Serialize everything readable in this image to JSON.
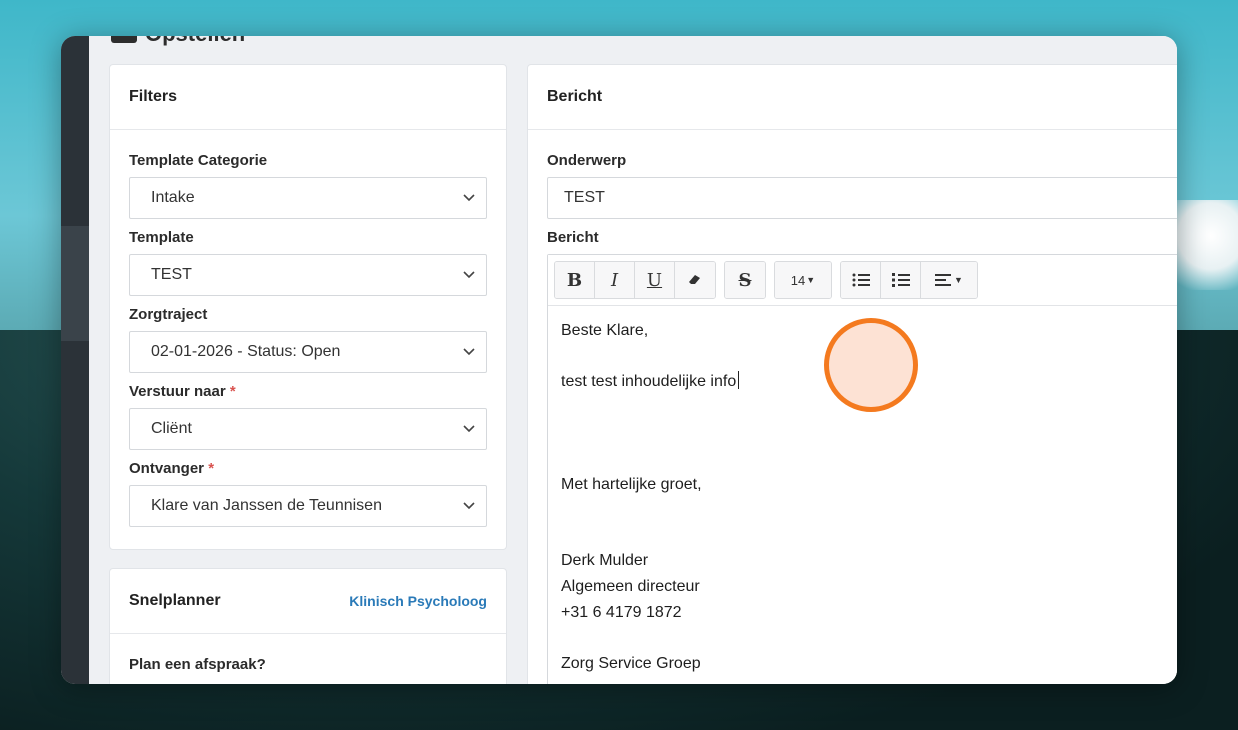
{
  "page": {
    "title": "Opstellen"
  },
  "filters": {
    "heading": "Filters",
    "template_categorie": {
      "label": "Template Categorie",
      "value": "Intake"
    },
    "template": {
      "label": "Template",
      "value": "TEST"
    },
    "zorgtraject": {
      "label": "Zorgtraject",
      "value": "02-01-2026 - Status: Open"
    },
    "verstuur_naar": {
      "label": "Verstuur naar",
      "required_mark": "*",
      "value": "Cliënt"
    },
    "ontvanger": {
      "label": "Ontvanger",
      "required_mark": "*",
      "value": "Klare van Janssen de Teunnisen"
    }
  },
  "snelplanner": {
    "heading": "Snelplanner",
    "link": "Klinisch Psycholoog",
    "question": "Plan een afspraak?"
  },
  "bericht": {
    "heading": "Bericht",
    "onderwerp": {
      "label": "Onderwerp",
      "value": "TEST"
    },
    "bericht_label": "Bericht",
    "toolbar": {
      "bold": "B",
      "italic": "I",
      "underline": "U",
      "strike": "S",
      "font_size": "14"
    },
    "body_lines": [
      "Beste Klare,",
      "",
      "test test inhoudelijke info",
      "",
      "",
      "",
      "Met hartelijke groet,",
      "",
      "",
      "Derk Mulder",
      "Algemeen directeur",
      "+31 6 4179 1872",
      "",
      "Zorg Service Groep"
    ]
  },
  "colors": {
    "accent_link": "#2a7ab8",
    "pointer_ring": "#f47a1f",
    "required": "#d9534f"
  }
}
